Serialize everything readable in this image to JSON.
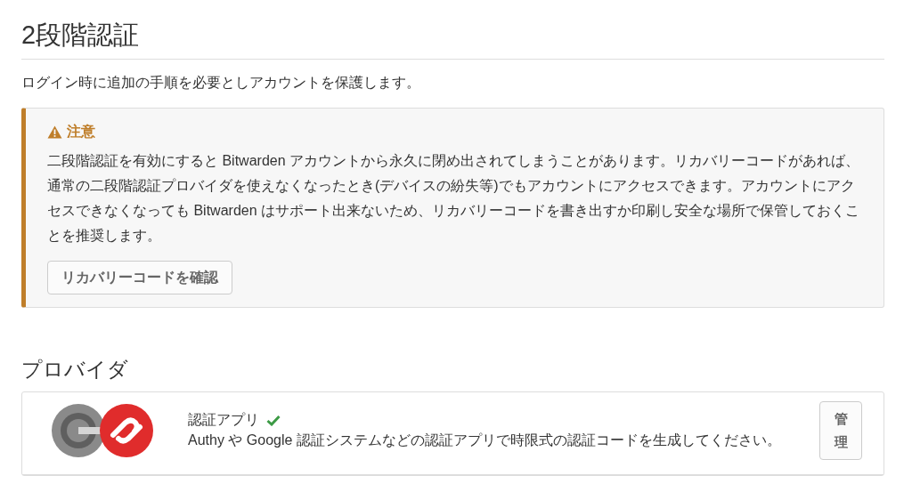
{
  "page_title": "2段階認証",
  "description": "ログイン時に追加の手順を必要としアカウントを保護します。",
  "warning": {
    "title": "注意",
    "text": "二段階認証を有効にすると Bitwarden アカウントから永久に閉め出されてしまうことがあります。リカバリーコードがあれば、通常の二段階認証プロバイダを使えなくなったとき(デバイスの紛失等)でもアカウントにアクセスできます。アカウントにアクセスできなくなっても Bitwarden はサポート出来ないため、リカバリーコードを書き出すか印刷し安全な場所で保管しておくことを推奨します。",
    "button": "リカバリーコードを確認"
  },
  "providers": {
    "title": "プロバイダ",
    "items": [
      {
        "name": "認証アプリ",
        "enabled": true,
        "description": "Authy や Google 認証システムなどの認証アプリで時限式の認証コードを生成してください。",
        "button": "管理"
      }
    ]
  }
}
